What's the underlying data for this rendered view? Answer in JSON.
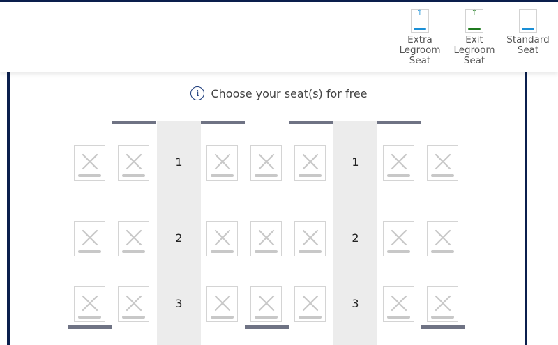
{
  "legend": {
    "items": [
      {
        "key": "extra-legroom",
        "label": "Extra\nLegroom\nSeat",
        "bar_color": "#1a8fd6",
        "arrow": "↑",
        "arrow_color": "#1a8fd6"
      },
      {
        "key": "exit-legroom",
        "label": "Exit\nLegroom\nSeat",
        "bar_color": "#1f7a1f",
        "arrow": "↑",
        "arrow_color": "#1f7a1f"
      },
      {
        "key": "standard",
        "label": "Standard\nSeat",
        "bar_color": "#1a8fd6",
        "arrow": "",
        "arrow_color": "#1a8fd6"
      }
    ]
  },
  "notice": {
    "icon": "info-icon",
    "glyph": "i",
    "text": "Choose your seat(s) for free"
  },
  "rows": [
    {
      "number": "1",
      "seats": [
        "unavailable",
        "unavailable",
        "unavailable",
        "unavailable",
        "unavailable",
        "unavailable",
        "unavailable"
      ]
    },
    {
      "number": "2",
      "seats": [
        "unavailable",
        "unavailable",
        "unavailable",
        "unavailable",
        "unavailable",
        "unavailable",
        "unavailable"
      ]
    },
    {
      "number": "3",
      "seats": [
        "unavailable",
        "unavailable",
        "unavailable",
        "unavailable",
        "unavailable",
        "unavailable",
        "unavailable"
      ]
    }
  ],
  "colors": {
    "frame": "#0b1f4d",
    "aisle": "#ececec",
    "wall": "#6f7384",
    "seat_unavailable": "#c8c8c8"
  }
}
